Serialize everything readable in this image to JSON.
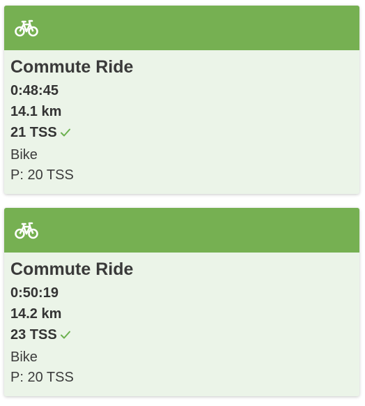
{
  "colors": {
    "header_green": "#76b052",
    "card_background": "#ebf4e8",
    "check_green": "#6bb04e",
    "text": "#333333"
  },
  "workouts": [
    {
      "icon": "bike-icon",
      "title": "Commute Ride",
      "duration": "0:48:45",
      "distance": "14.1 km",
      "tss": "21 TSS",
      "completed_icon": "check-icon",
      "sport": "Bike",
      "planned": "P: 20 TSS"
    },
    {
      "icon": "bike-icon",
      "title": "Commute Ride",
      "duration": "0:50:19",
      "distance": "14.2 km",
      "tss": "23 TSS",
      "completed_icon": "check-icon",
      "sport": "Bike",
      "planned": "P: 20 TSS"
    }
  ]
}
